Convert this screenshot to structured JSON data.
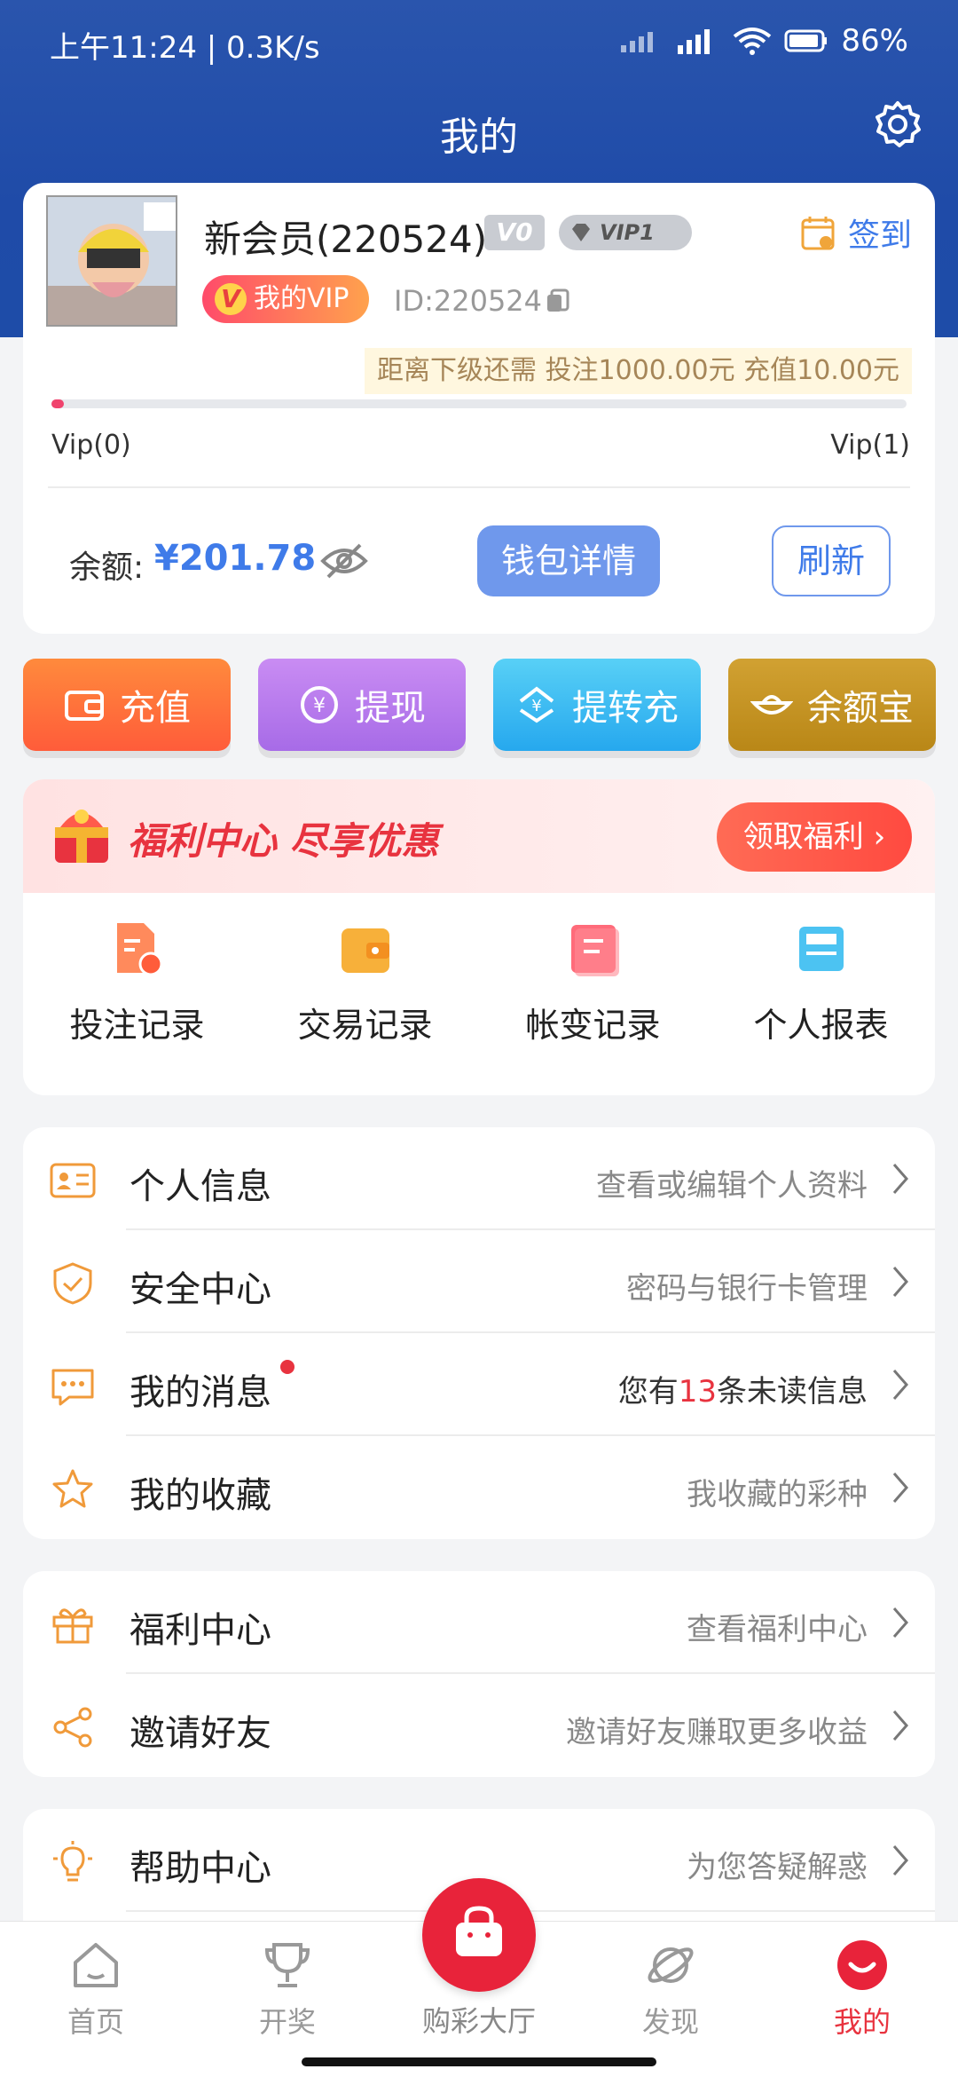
{
  "status_bar": {
    "time": "上午11:24 | 0.3K/s",
    "battery": "86%"
  },
  "header": {
    "title": "我的"
  },
  "profile": {
    "username": "新会员(220524)",
    "level_badge": "V0",
    "vip_badge": "VIP1",
    "vip_pill": "我的VIP",
    "vip_pill_mark": "V",
    "user_id": "ID:220524",
    "checkin_label": "签到",
    "level_tip": "距离下级还需  投注1000.00元  充值10.00元",
    "progress": 0.0,
    "vip_from": "Vip(0)",
    "vip_to": "Vip(1)",
    "balance_label": "余额:",
    "balance_value": "¥201.78",
    "wallet_button": "钱包详情",
    "refresh_button": "刷新"
  },
  "actions": [
    {
      "label": "充值",
      "color": "#ff6a3a"
    },
    {
      "label": "提现",
      "color": "#b57ced"
    },
    {
      "label": "提转充",
      "color": "#34b8f1"
    },
    {
      "label": "余额宝",
      "color": "#c4951f"
    }
  ],
  "welfare": {
    "title": "福利中心 尽享优惠",
    "claim_button": "领取福利",
    "records": [
      {
        "label": "投注记录",
        "icon": "bet-record-icon"
      },
      {
        "label": "交易记录",
        "icon": "wallet-record-icon"
      },
      {
        "label": "帐变记录",
        "icon": "account-change-icon"
      },
      {
        "label": "个人报表",
        "icon": "report-icon"
      }
    ]
  },
  "menu": {
    "group1": [
      {
        "label": "个人信息",
        "desc": "查看或编辑个人资料",
        "icon": "id-card-icon"
      },
      {
        "label": "安全中心",
        "desc": "密码与银行卡管理",
        "icon": "shield-icon"
      },
      {
        "label": "我的消息",
        "desc_prefix": "您有",
        "desc_num": "13",
        "desc_suffix": "条未读信息",
        "icon": "message-icon"
      },
      {
        "label": "我的收藏",
        "desc": "我收藏的彩种",
        "icon": "star-icon"
      }
    ],
    "group2": [
      {
        "label": "福利中心",
        "desc": "查看福利中心",
        "icon": "gift-icon"
      },
      {
        "label": "邀请好友",
        "desc": "邀请好友赚取更多收益",
        "icon": "share-icon"
      }
    ],
    "group3": [
      {
        "label": "帮助中心",
        "desc": "为您答疑解惑",
        "icon": "bulb-icon"
      }
    ]
  },
  "tabbar": {
    "home": "首页",
    "lottery": "开奖",
    "hall": "购彩大厅",
    "discover": "发现",
    "mine": "我的"
  },
  "colors": {
    "header": "#2a55ad",
    "accent_blue": "#3f7be9",
    "accent_red": "#e8333f"
  }
}
